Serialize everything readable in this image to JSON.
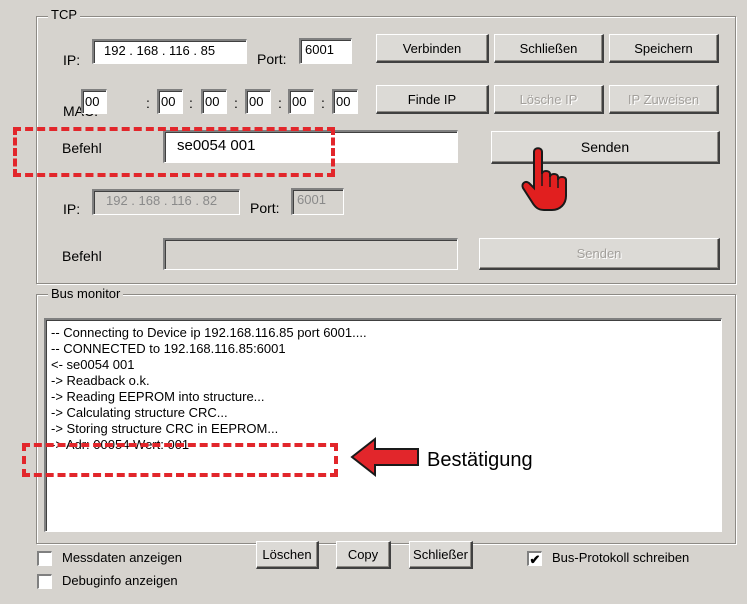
{
  "tcp": {
    "legend": "TCP",
    "ip_label": "IP:",
    "ip_value": "192 . 168 . 116 . 85",
    "port_label": "Port:",
    "port_value": "6001",
    "connect_label": "Verbinden",
    "close_label": "Schließen",
    "save_label": "Speichern",
    "mac_label": "MAC:",
    "mac": [
      "00",
      "00",
      "00",
      "00",
      "00",
      "00"
    ],
    "mac_sep": ":",
    "find_ip_label": "Finde IP",
    "delete_ip_label": "Lösche IP",
    "assign_ip_label": "IP Zuweisen",
    "command_label": "Befehl",
    "command_value": "se0054 001",
    "send_label": "Senden",
    "ip2_label": "IP:",
    "ip2_value": "192 . 168 . 116 . 82",
    "port2_label": "Port:",
    "port2_value": "6001",
    "command2_label": "Befehl",
    "command2_value": "",
    "send2_label": "Senden"
  },
  "bus_monitor": {
    "legend": "Bus monitor",
    "lines": [
      "-- Connecting to Device ip 192.168.116.85 port 6001....",
      "-- CONNECTED to 192.168.116.85:6001",
      "<- se0054 001",
      "-> Readback o.k.",
      "-> Reading EEPROM into structure...",
      "-> Calculating structure CRC...",
      "-> Storing structure CRC in EEPROM...",
      "-> Adr: 00054 Wert: 001"
    ]
  },
  "annotation": {
    "label": "Bestätigung",
    "color": "#e2262b"
  },
  "bottom": {
    "show_measure_label": "Messdaten anzeigen",
    "show_measure_checked": false,
    "show_debug_label": "Debuginfo anzeigen",
    "show_debug_checked": false,
    "clear_label": "Löschen",
    "copy_label": "Copy",
    "close_label": "Schließer",
    "bus_protocol_label": "Bus-Protokoll schreiben",
    "bus_protocol_checked": true
  },
  "icons": {
    "pointer": "hand-pointer-icon",
    "arrow": "arrow-left-icon",
    "check": "checkmark-icon"
  }
}
